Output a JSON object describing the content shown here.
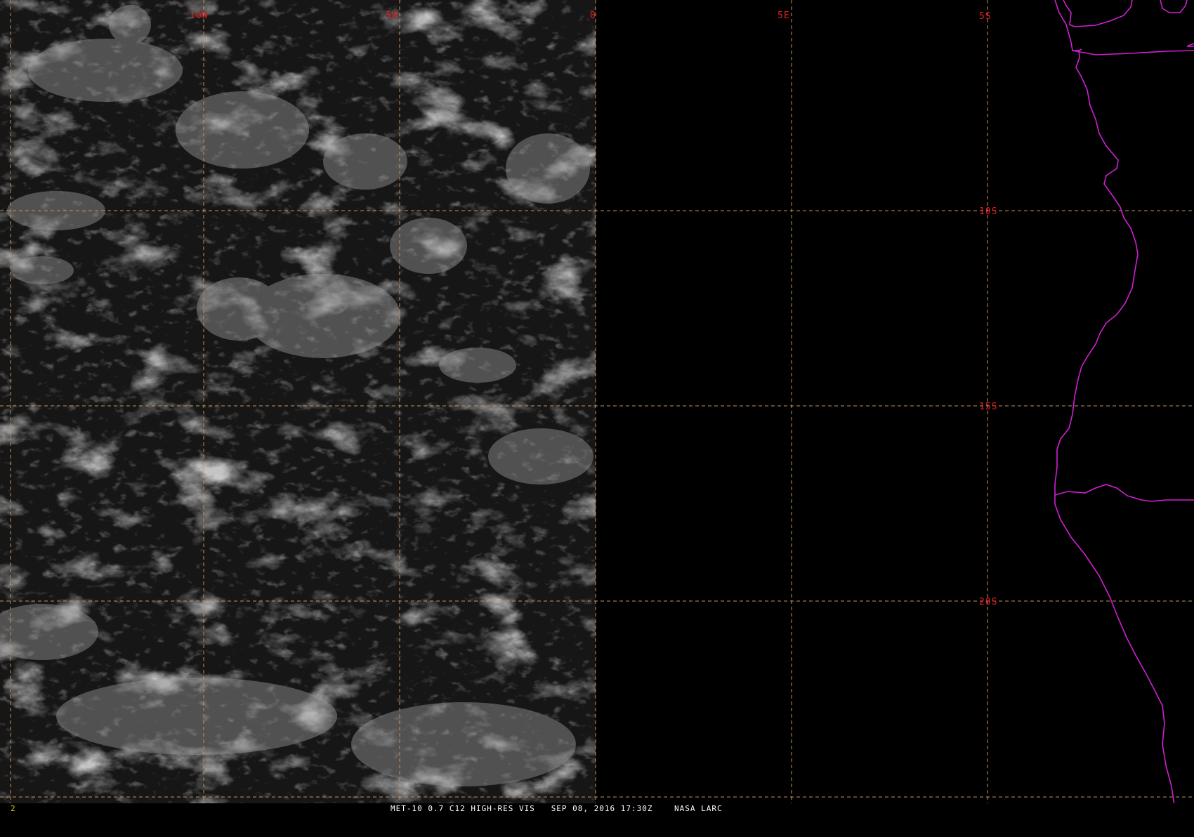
{
  "map": {
    "product_title": "MET-10 0.7 C12 HIGH-RES VIS",
    "timestamp": "SEP 08, 2016 17:30Z",
    "source": "NASA LARC",
    "frame_number": "2",
    "longitude_lines": [
      {
        "label": "10W",
        "lon": -10
      },
      {
        "label": "5W",
        "lon": -5
      },
      {
        "label": "0",
        "lon": 0
      },
      {
        "label": "5E",
        "lon": 5
      }
    ],
    "latitude_lines": [
      {
        "label": "5S",
        "lat": -5
      },
      {
        "label": "10S",
        "lat": -10
      },
      {
        "label": "15S",
        "lat": -15
      },
      {
        "label": "20S",
        "lat": -20
      }
    ],
    "colors": {
      "grid": "#c8905a",
      "grid_label": "#e02020",
      "coastline": "#d020d0",
      "background": "#000000",
      "imagery_base": "#161616"
    },
    "coastline_icon": "magenta-coastline-overlay",
    "imagery_coverage": "west of 0 longitude"
  }
}
